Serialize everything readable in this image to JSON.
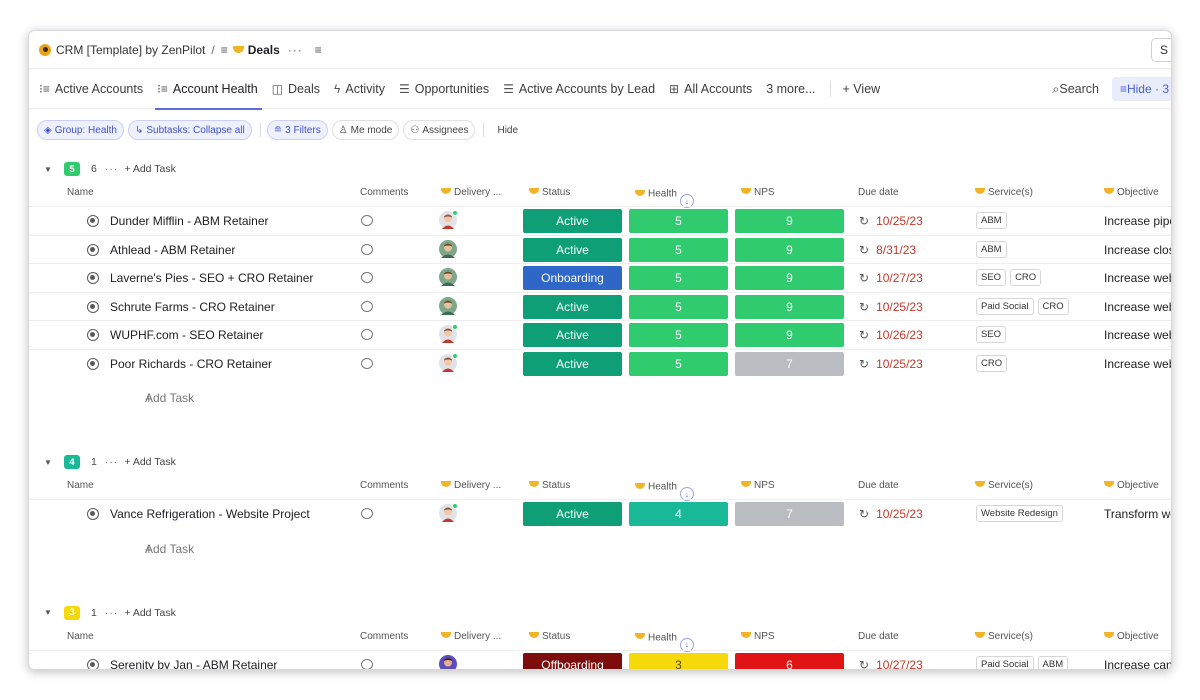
{
  "breadcrumb": {
    "workspace": "CRM [Template] by ZenPilot",
    "separator": "/",
    "list_icon": "≡",
    "list_name": "Deals",
    "more": "···",
    "menu": "≡",
    "corner_letter": "S"
  },
  "tabs": [
    {
      "icon": "hierarchy-icon",
      "glyph": "⁝≡",
      "label": "Active Accounts",
      "active": false
    },
    {
      "icon": "list-icon",
      "glyph": "⁝≡",
      "label": "Account Health",
      "active": true
    },
    {
      "icon": "board-icon",
      "glyph": "◫",
      "label": "Deals",
      "active": false
    },
    {
      "icon": "activity-icon",
      "glyph": "ϟ",
      "label": "Activity",
      "active": false
    },
    {
      "icon": "list-icon",
      "glyph": "☰",
      "label": "Opportunities",
      "active": false
    },
    {
      "icon": "list-icon",
      "glyph": "☰",
      "label": "Active Accounts by Lead",
      "active": false
    },
    {
      "icon": "table-icon",
      "glyph": "⊞",
      "label": "All Accounts",
      "active": false
    },
    {
      "icon": "",
      "glyph": "",
      "label": "3 more...",
      "active": false
    }
  ],
  "add_view": "+ View",
  "search_label": "Search",
  "hide_label": "Hide · 3",
  "chips": {
    "group": "Group: Health",
    "subtasks": "Subtasks: Collapse all",
    "filters": "3 Filters",
    "me_mode": "Me mode",
    "assignees": "Assignees",
    "hide": "Hide"
  },
  "columns": {
    "name": "Name",
    "comments": "Comments",
    "delivery": "Delivery ...",
    "status": "Status",
    "health": "Health",
    "nps": "NPS",
    "due_date": "Due date",
    "services": "Service(s)",
    "objective": "Objective"
  },
  "group_more": "···",
  "add_task_header": "+ Add Task",
  "add_task_row": "Add Task",
  "colors": {
    "active": "#0e9f77",
    "onboarding": "#2f67c8",
    "offboarding": "#7d0d0d",
    "health5": "#2fcb6e",
    "health4": "#19b998",
    "health3": "#f5d90a",
    "nps9": "#2fcb6e",
    "nps7": "#b9bcc1",
    "nps6": "#e01414",
    "badge5": "#2fcb6e",
    "badge4": "#19b998",
    "badge3": "#f5d90a"
  },
  "groups": [
    {
      "badge": "5",
      "badge_color": "#2fcb6e",
      "count": "6",
      "tasks": [
        {
          "name": "Dunder Mifflin - ABM Retainer",
          "avatar": "a",
          "status": "Active",
          "status_color": "#0e9f77",
          "health": "5",
          "health_color": "#2fcb6e",
          "nps": "9",
          "nps_color": "#2fcb6e",
          "due": "10/25/23",
          "services": [
            "ABM"
          ],
          "objective": "Increase pipe"
        },
        {
          "name": "Athlead - ABM Retainer",
          "avatar": "b",
          "status": "Active",
          "status_color": "#0e9f77",
          "health": "5",
          "health_color": "#2fcb6e",
          "nps": "9",
          "nps_color": "#2fcb6e",
          "due": "8/31/23",
          "services": [
            "ABM"
          ],
          "objective": "Increase clos"
        },
        {
          "name": "Laverne's Pies - SEO + CRO Retainer",
          "avatar": "b",
          "status": "Onboarding",
          "status_color": "#2f67c8",
          "health": "5",
          "health_color": "#2fcb6e",
          "nps": "9",
          "nps_color": "#2fcb6e",
          "due": "10/27/23",
          "services": [
            "SEO",
            "CRO"
          ],
          "objective": "Increase web"
        },
        {
          "name": "Schrute Farms - CRO Retainer",
          "avatar": "b",
          "status": "Active",
          "status_color": "#0e9f77",
          "health": "5",
          "health_color": "#2fcb6e",
          "nps": "9",
          "nps_color": "#2fcb6e",
          "due": "10/25/23",
          "services": [
            "Paid Social",
            "CRO"
          ],
          "objective": "Increase web"
        },
        {
          "name": "WUPHF.com - SEO Retainer",
          "avatar": "a",
          "status": "Active",
          "status_color": "#0e9f77",
          "health": "5",
          "health_color": "#2fcb6e",
          "nps": "9",
          "nps_color": "#2fcb6e",
          "due": "10/26/23",
          "services": [
            "SEO"
          ],
          "objective": "Increase web"
        },
        {
          "name": "Poor Richards - CRO Retainer",
          "avatar": "a",
          "status": "Active",
          "status_color": "#0e9f77",
          "health": "5",
          "health_color": "#2fcb6e",
          "nps": "7",
          "nps_color": "#b9bcc1",
          "due": "10/25/23",
          "services": [
            "CRO"
          ],
          "objective": "Increase web"
        }
      ]
    },
    {
      "badge": "4",
      "badge_color": "#19b998",
      "count": "1",
      "tasks": [
        {
          "name": "Vance Refrigeration - Website Project",
          "avatar": "a",
          "status": "Active",
          "status_color": "#0e9f77",
          "health": "4",
          "health_color": "#19b998",
          "nps": "7",
          "nps_color": "#b9bcc1",
          "due": "10/25/23",
          "services": [
            "Website Redesign"
          ],
          "objective": "Transform we"
        }
      ]
    },
    {
      "badge": "3",
      "badge_color": "#f5d90a",
      "count": "1",
      "tasks": [
        {
          "name": "Serenity by Jan - ABM Retainer",
          "avatar": "c",
          "status": "Offboarding",
          "status_color": "#7d0d0d",
          "health": "3",
          "health_color": "#f5d90a",
          "health_text_color": "#5a4a00",
          "nps": "6",
          "nps_color": "#e01414",
          "due": "10/27/23",
          "services": [
            "Paid Social",
            "ABM"
          ],
          "objective": "Increase canc"
        }
      ]
    }
  ]
}
